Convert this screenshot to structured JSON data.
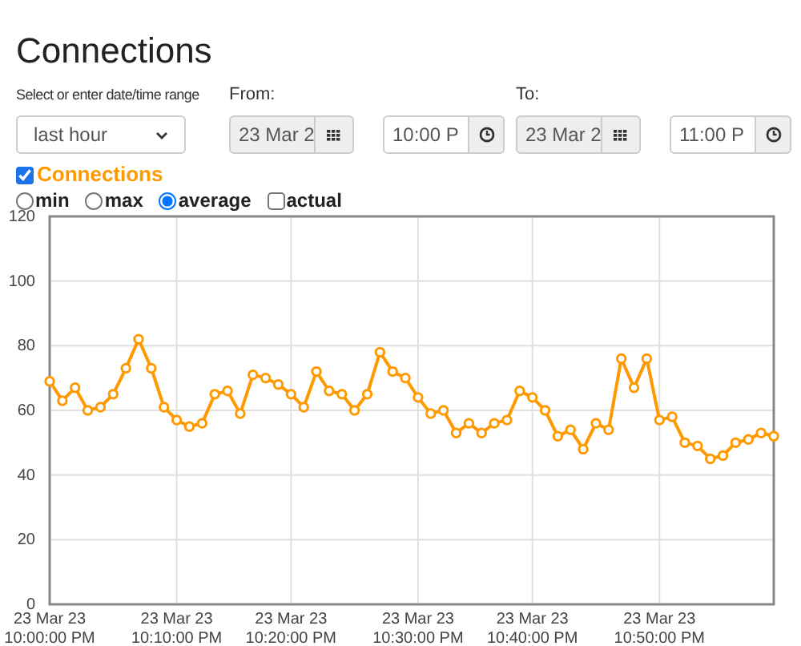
{
  "title": "Connections",
  "range": {
    "label": "Select or enter date/time range",
    "value": "last hour"
  },
  "from": {
    "label": "From:",
    "date": "23 Mar 2",
    "time": "10:00 P"
  },
  "to": {
    "label": "To:",
    "date": "23 Mar 2",
    "time": "11:00 P"
  },
  "series_toggle": {
    "label": "Connections",
    "checked": true,
    "color": "#ff9900"
  },
  "modes": [
    {
      "kind": "radio",
      "label": "min",
      "selected": false
    },
    {
      "kind": "radio",
      "label": "max",
      "selected": false
    },
    {
      "kind": "radio",
      "label": "average",
      "selected": true
    },
    {
      "kind": "checkbox",
      "label": "actual",
      "selected": false
    }
  ],
  "chart_data": {
    "type": "line",
    "grid": true,
    "ylim": [
      0,
      120
    ],
    "yticks": [
      0,
      20,
      40,
      60,
      80,
      100,
      120
    ],
    "categories": [
      "23 Mar 23 10:00:00 PM",
      null,
      null,
      null,
      null,
      null,
      null,
      null,
      null,
      null,
      "23 Mar 23 10:10:00 PM",
      null,
      null,
      null,
      null,
      null,
      null,
      null,
      null,
      "23 Mar 23 10:20:00 PM",
      null,
      null,
      null,
      null,
      null,
      null,
      null,
      null,
      null,
      "23 Mar 23 10:30:00 PM",
      null,
      null,
      null,
      null,
      null,
      null,
      null,
      null,
      "23 Mar 23 10:40:00 PM",
      null,
      null,
      null,
      null,
      null,
      null,
      null,
      null,
      null,
      "23 Mar 23 10:50:00 PM",
      null,
      null,
      null,
      null,
      null,
      null,
      null,
      null,
      null
    ],
    "series": [
      {
        "color": "#ff9900",
        "marker": "circle",
        "values": [
          69,
          63,
          67,
          60,
          61,
          65,
          73,
          82,
          73,
          61,
          57,
          55,
          56,
          65,
          66,
          59,
          71,
          70,
          68,
          65,
          61,
          72,
          66,
          65,
          60,
          65,
          78,
          72,
          70,
          64,
          59,
          60,
          53,
          56,
          53,
          56,
          57,
          66,
          64,
          60,
          52,
          54,
          48,
          56,
          54,
          76,
          67,
          76,
          57,
          58,
          50,
          49,
          45,
          46,
          50,
          51,
          53,
          52
        ]
      }
    ]
  }
}
